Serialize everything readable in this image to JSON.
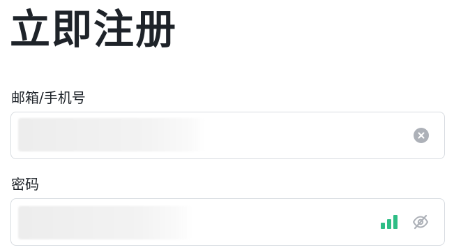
{
  "header": {
    "title": "立即注册"
  },
  "email": {
    "label": "邮箱/手机号",
    "clear_icon": "close-circle-icon"
  },
  "password": {
    "label": "密码",
    "strength_level": 3,
    "strength_max": 3,
    "strength_color": "#2ebd85",
    "visibility_icon": "eye-off-icon"
  },
  "colors": {
    "text": "#1e2329",
    "border": "#d8dce1",
    "icon": "#adb1b8",
    "success": "#2ebd85"
  }
}
